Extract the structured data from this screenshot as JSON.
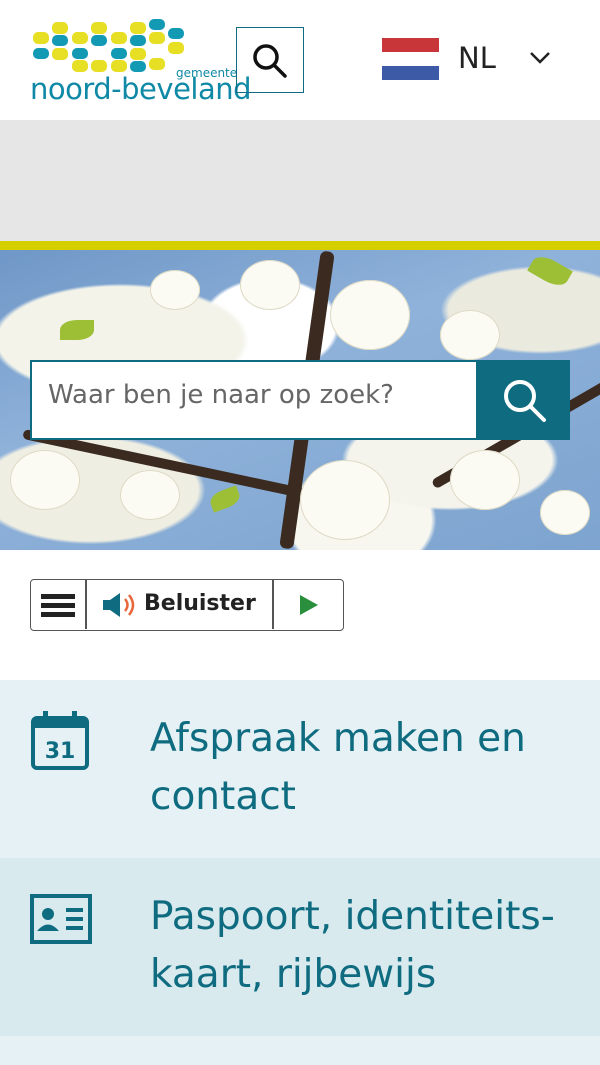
{
  "header": {
    "logo_name": "noord-beveland",
    "logo_sub": "gemeente",
    "search_button_label": "Zoeken",
    "language": "NL",
    "flag_colors": [
      "#c8363a",
      "#ffffff",
      "#3c5aa6"
    ]
  },
  "search": {
    "placeholder": "Waar ben je naar op zoek?"
  },
  "readspeaker": {
    "listen_label": "Beluister"
  },
  "tiles": [
    {
      "title": "Afspraak maken en contact",
      "icon": "calendar-icon",
      "icon_text": "31"
    },
    {
      "title": "Paspoort, identiteits-kaart, rijbewijs",
      "icon": "id-card-icon"
    }
  ],
  "colors": {
    "brand": "#0e6b80",
    "accent": "#d6cf00",
    "tile_bg": "#e5f1f4"
  }
}
